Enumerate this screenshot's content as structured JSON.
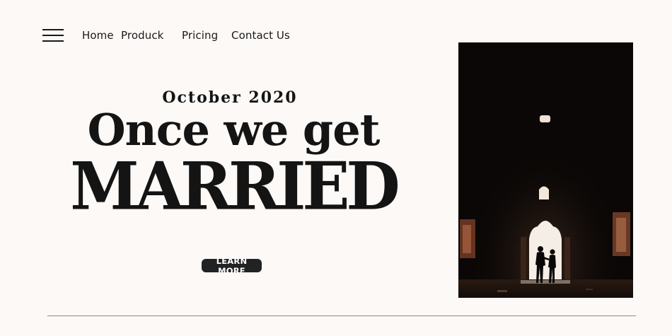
{
  "nav": {
    "home": "Home",
    "produck": "Produck",
    "pricing": "Pricing",
    "contact": "Contact Us"
  },
  "hero": {
    "date": "October 2020",
    "line1": "Once we get",
    "line2": "MARRIED",
    "cta": "LEARN MORE"
  },
  "colors": {
    "background": "#fcf9f7",
    "text": "#141414",
    "button": "#222222",
    "photo_dark": "#0a0706",
    "arch_light": "#f5eee6",
    "warm_wall": "#b86a4a"
  },
  "icons": {
    "menu": "hamburger-menu-icon"
  }
}
